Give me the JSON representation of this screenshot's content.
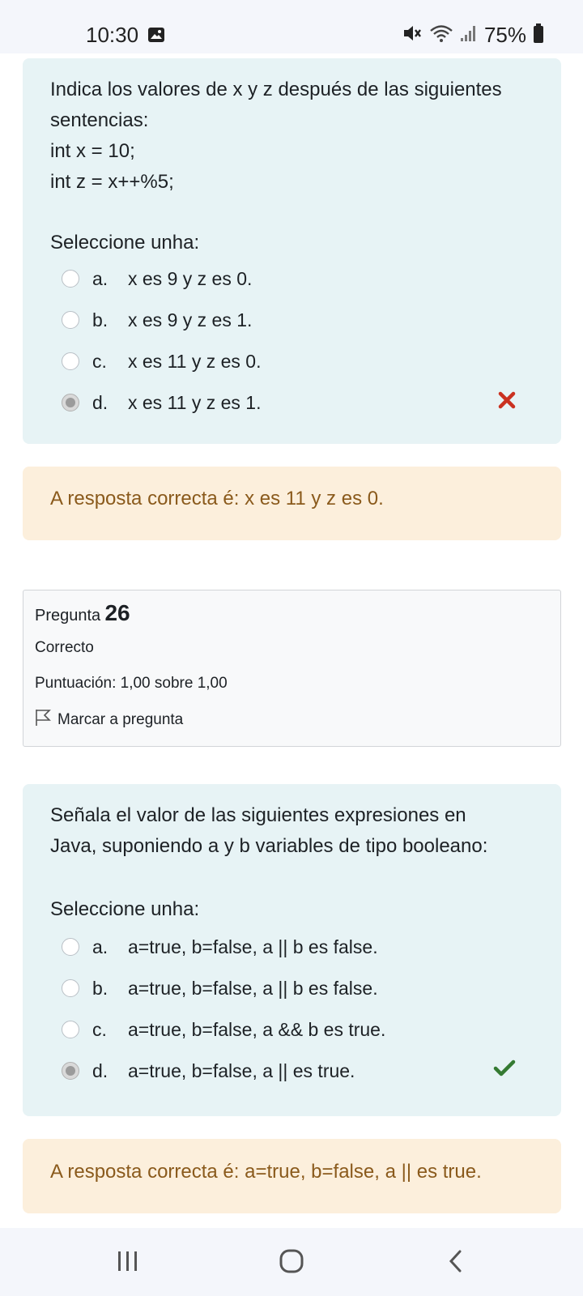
{
  "status_bar": {
    "time": "10:30",
    "battery": "75%",
    "icons": [
      "gallery-icon",
      "mute-icon",
      "wifi-icon",
      "signal-icon",
      "battery-icon"
    ]
  },
  "question1": {
    "text_lines": [
      "Indica los valores de x y z después de las siguientes",
      "sentencias:",
      "int x = 10;",
      "int z = x++%5;"
    ],
    "prompt": "Seleccione unha:",
    "options": [
      {
        "letter": "a.",
        "text": "x es 9 y z es 0.",
        "selected": false
      },
      {
        "letter": "b.",
        "text": "x es 9 y z es 1.",
        "selected": false
      },
      {
        "letter": "c.",
        "text": "x es 11 y z es 0.",
        "selected": false
      },
      {
        "letter": "d.",
        "text": "x es 11 y z es 1.",
        "selected": true,
        "mark": "incorrect-x-icon"
      }
    ],
    "feedback": "A resposta correcta é: x es 11 y z es 0."
  },
  "question2_info": {
    "label": "Pregunta",
    "number": "26",
    "state": "Correcto",
    "score": "Puntuación: 1,00 sobre 1,00",
    "flag_label": "Marcar a pregunta"
  },
  "question2": {
    "text_lines": [
      "Señala el valor de las siguientes expresiones en",
      "Java, suponiendo a y b variables de tipo booleano:"
    ],
    "prompt": "Seleccione unha:",
    "options": [
      {
        "letter": "a.",
        "text": "a=true, b=false, a || b es false.",
        "selected": false
      },
      {
        "letter": "b.",
        "text": "a=true, b=false, a || b es false.",
        "selected": false
      },
      {
        "letter": "c.",
        "text": "a=true, b=false, a && b es true.",
        "selected": false
      },
      {
        "letter": "d.",
        "text": "a=true, b=false, a || es true.",
        "selected": true,
        "mark": "correct-check-icon"
      }
    ],
    "feedback": "A resposta correcta é: a=true, b=false, a || es true."
  },
  "colors": {
    "question_bg": "#e7f3f5",
    "feedback_bg": "#fcefdc",
    "feedback_text": "#8a5a1c",
    "incorrect": "#ca3120",
    "correct": "#357a32"
  }
}
